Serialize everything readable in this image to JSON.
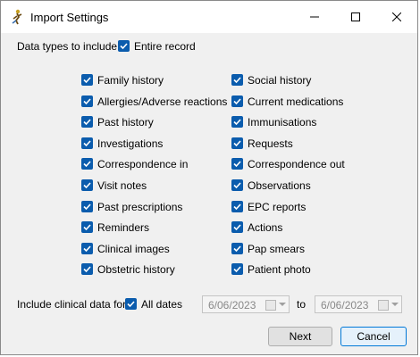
{
  "window": {
    "title": "Import Settings",
    "icon": "import-app-icon"
  },
  "data_types": {
    "label": "Data types to include:",
    "entire_record": {
      "label": "Entire record",
      "checked": true
    }
  },
  "left_items": [
    {
      "label": "Family history",
      "checked": true
    },
    {
      "label": "Allergies/Adverse reactions",
      "checked": true
    },
    {
      "label": "Past history",
      "checked": true
    },
    {
      "label": "Investigations",
      "checked": true
    },
    {
      "label": "Correspondence in",
      "checked": true
    },
    {
      "label": "Visit notes",
      "checked": true
    },
    {
      "label": "Past prescriptions",
      "checked": true
    },
    {
      "label": "Reminders",
      "checked": true
    },
    {
      "label": "Clinical images",
      "checked": true
    },
    {
      "label": "Obstetric history",
      "checked": true
    }
  ],
  "right_items": [
    {
      "label": "Social history",
      "checked": true
    },
    {
      "label": "Current medications",
      "checked": true
    },
    {
      "label": "Immunisations",
      "checked": true
    },
    {
      "label": "Requests",
      "checked": true
    },
    {
      "label": "Correspondence out",
      "checked": true
    },
    {
      "label": "Observations",
      "checked": true
    },
    {
      "label": "EPC reports",
      "checked": true
    },
    {
      "label": "Actions",
      "checked": true
    },
    {
      "label": "Pap smears",
      "checked": true
    },
    {
      "label": "Patient photo",
      "checked": true
    }
  ],
  "clinical": {
    "label": "Include clinical data for:",
    "all_dates": {
      "label": "All dates",
      "checked": true
    },
    "from_date": "6/06/2023",
    "to_label": "to",
    "to_date": "6/06/2023"
  },
  "buttons": {
    "next": "Next",
    "cancel": "Cancel"
  },
  "colors": {
    "checkbox": "#0b5cad",
    "default_button_border": "#0078d7"
  }
}
